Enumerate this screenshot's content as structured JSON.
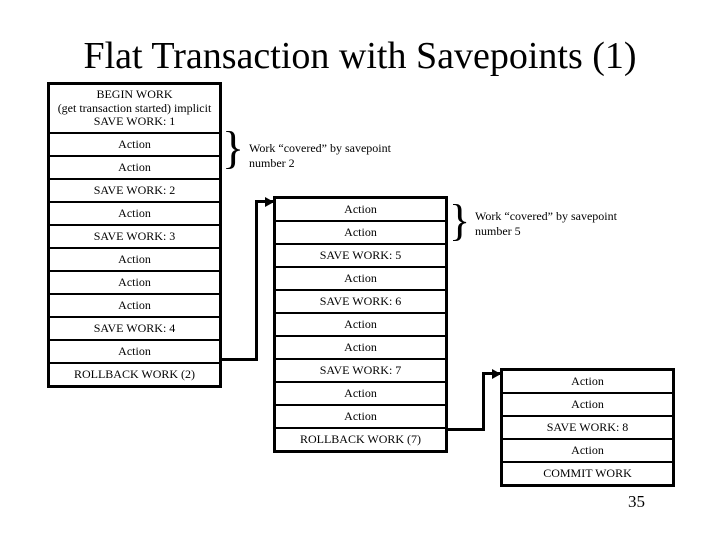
{
  "slide": {
    "title": "Flat Transaction with Savepoints (1)",
    "page_number": "35",
    "background_color": "#ffffff",
    "ink_color": "#000000"
  },
  "columns": [
    {
      "id": "col-1",
      "name": "transaction-column-1",
      "rows": [
        {
          "lines": [
            "BEGIN WORK",
            "(get transaction started) implicit",
            "SAVE WORK: 1"
          ]
        },
        {
          "lines": [
            "Action"
          ]
        },
        {
          "lines": [
            "Action"
          ]
        },
        {
          "lines": [
            "SAVE WORK: 2"
          ]
        },
        {
          "lines": [
            "Action"
          ]
        },
        {
          "lines": [
            "SAVE WORK: 3"
          ]
        },
        {
          "lines": [
            "Action"
          ]
        },
        {
          "lines": [
            "Action"
          ]
        },
        {
          "lines": [
            "Action"
          ]
        },
        {
          "lines": [
            "SAVE WORK: 4"
          ]
        },
        {
          "lines": [
            "Action"
          ]
        },
        {
          "lines": [
            "ROLLBACK WORK (2)"
          ]
        }
      ]
    },
    {
      "id": "col-2",
      "name": "transaction-column-2",
      "rows": [
        {
          "lines": [
            "Action"
          ]
        },
        {
          "lines": [
            "Action"
          ]
        },
        {
          "lines": [
            "SAVE WORK: 5"
          ]
        },
        {
          "lines": [
            "Action"
          ]
        },
        {
          "lines": [
            "SAVE WORK: 6"
          ]
        },
        {
          "lines": [
            "Action"
          ]
        },
        {
          "lines": [
            "Action"
          ]
        },
        {
          "lines": [
            "SAVE WORK: 7"
          ]
        },
        {
          "lines": [
            "Action"
          ]
        },
        {
          "lines": [
            "Action"
          ]
        },
        {
          "lines": [
            "ROLLBACK WORK (7)"
          ]
        }
      ]
    },
    {
      "id": "col-3",
      "name": "transaction-column-3",
      "rows": [
        {
          "lines": [
            "Action"
          ]
        },
        {
          "lines": [
            "Action"
          ]
        },
        {
          "lines": [
            "SAVE WORK: 8"
          ]
        },
        {
          "lines": [
            "Action"
          ]
        },
        {
          "lines": [
            "COMMIT WORK"
          ]
        }
      ]
    }
  ],
  "annotations": [
    {
      "name": "savepoint-2-annotation",
      "brace": "}",
      "lines": [
        "Work “covered” by savepoint",
        "number 2"
      ]
    },
    {
      "name": "savepoint-5-annotation",
      "brace": "}",
      "lines": [
        "Work “covered” by savepoint",
        "number 5"
      ]
    }
  ],
  "connectors": [
    {
      "name": "rollback-2-connector",
      "from": "ROLLBACK WORK (2)",
      "to": "transaction-column-2"
    },
    {
      "name": "rollback-7-connector",
      "from": "ROLLBACK WORK (7)",
      "to": "transaction-column-3"
    }
  ]
}
